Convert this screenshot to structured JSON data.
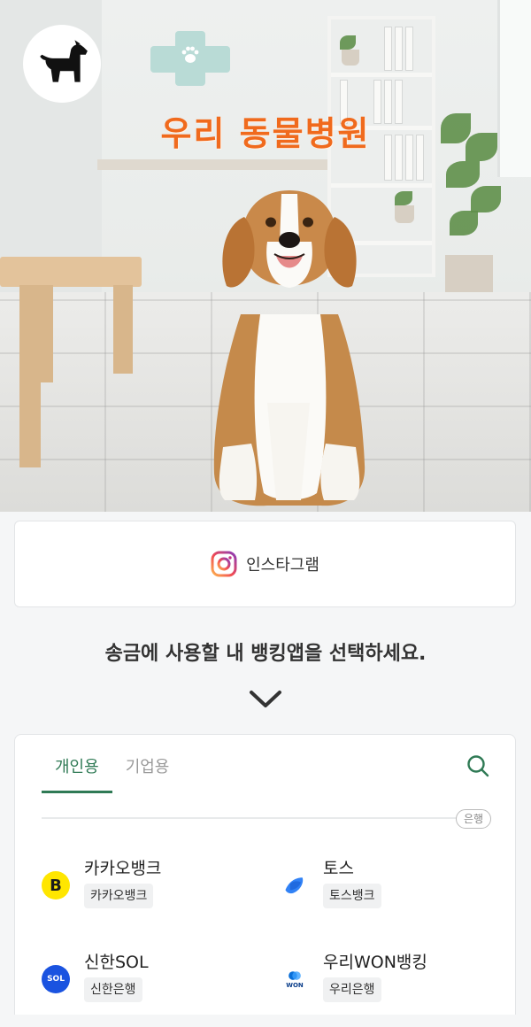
{
  "hero": {
    "title": "우리 동물병원"
  },
  "social": {
    "label": "인스타그램",
    "icon": "instagram-icon"
  },
  "instruction": "송금에 사용할 내 뱅킹앱을 선택하세요.",
  "tabs": [
    {
      "label": "개인용",
      "active": true
    },
    {
      "label": "기업용",
      "active": false
    }
  ],
  "category_chip": "은행",
  "banks": [
    {
      "name": "카카오뱅크",
      "tag": "카카오뱅크",
      "icon": "kakaobank-icon",
      "logo_text": "B",
      "color": "#ffe600"
    },
    {
      "name": "토스",
      "tag": "토스뱅크",
      "icon": "toss-icon",
      "logo_text": "",
      "color": "#3182f6"
    },
    {
      "name": "신한SOL",
      "tag": "신한은행",
      "icon": "shinhan-sol-icon",
      "logo_text": "SOL",
      "color": "#1a53e0"
    },
    {
      "name": "우리WON뱅킹",
      "tag": "우리은행",
      "icon": "woori-won-icon",
      "logo_text": "WON",
      "color": "#0a6fd8"
    }
  ],
  "colors": {
    "accent": "#2f7a55",
    "title_orange": "#f06a1d"
  }
}
